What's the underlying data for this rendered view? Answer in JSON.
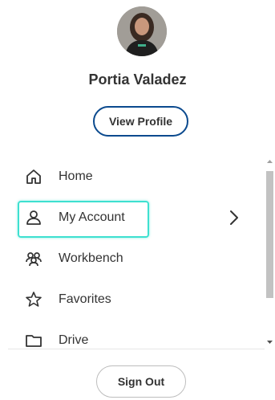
{
  "profile": {
    "name": "Portia Valadez",
    "view_profile_label": "View Profile"
  },
  "menu": {
    "items": [
      {
        "label": "Home",
        "icon": "home-icon"
      },
      {
        "label": "My Account",
        "icon": "user-icon",
        "focused": true,
        "has_submenu": true
      },
      {
        "label": "Workbench",
        "icon": "users-group-icon"
      },
      {
        "label": "Favorites",
        "icon": "star-icon"
      },
      {
        "label": "Drive",
        "icon": "folder-icon"
      }
    ]
  },
  "footer": {
    "sign_out_label": "Sign Out"
  },
  "colors": {
    "primary_border": "#0b4a8e",
    "focus_ring": "#3ee0d0",
    "text": "#333333"
  }
}
